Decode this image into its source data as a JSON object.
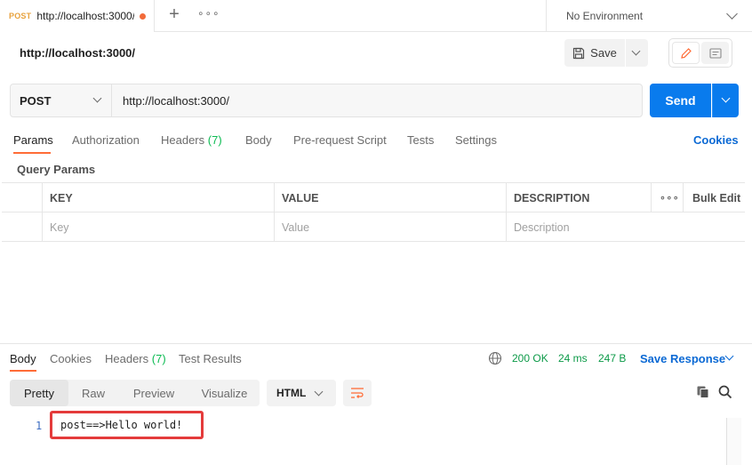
{
  "tab": {
    "method": "POST",
    "url": "http://localhost:3000/",
    "unsaved": true
  },
  "tabbar": {
    "add_label": "+",
    "more_label": "∘∘∘"
  },
  "environment": {
    "label": "No Environment"
  },
  "request": {
    "title": "http://localhost:3000/",
    "method": "POST",
    "url": "http://localhost:3000/",
    "save_label": "Save",
    "send_label": "Send"
  },
  "request_tabs": [
    {
      "label": "Params",
      "active": true
    },
    {
      "label": "Authorization"
    },
    {
      "label": "Headers",
      "count": "(7)"
    },
    {
      "label": "Body"
    },
    {
      "label": "Pre-request Script"
    },
    {
      "label": "Tests"
    },
    {
      "label": "Settings"
    }
  ],
  "cookies_label": "Cookies",
  "query_params": {
    "label": "Query Params",
    "columns": [
      "KEY",
      "VALUE",
      "DESCRIPTION"
    ],
    "more_label": "∘∘∘",
    "bulk_edit_label": "Bulk Edit",
    "placeholders": [
      "Key",
      "Value",
      "Description"
    ]
  },
  "response": {
    "tabs": [
      {
        "label": "Body",
        "active": true
      },
      {
        "label": "Cookies"
      },
      {
        "label": "Headers",
        "count": "(7)"
      },
      {
        "label": "Test Results"
      }
    ],
    "status": "200 OK",
    "time": "24 ms",
    "size": "247 B",
    "save_response_label": "Save Response",
    "view_modes": [
      "Pretty",
      "Raw",
      "Preview",
      "Visualize"
    ],
    "active_view": "Pretty",
    "format": "HTML",
    "lines": [
      {
        "number": "1",
        "text": "post==>Hello world!"
      }
    ]
  },
  "colors": {
    "accent": "#ff6c37",
    "send": "#097bed",
    "link": "#0b69d4",
    "success": "#0c9a48",
    "highlight": "#e43b3b"
  }
}
